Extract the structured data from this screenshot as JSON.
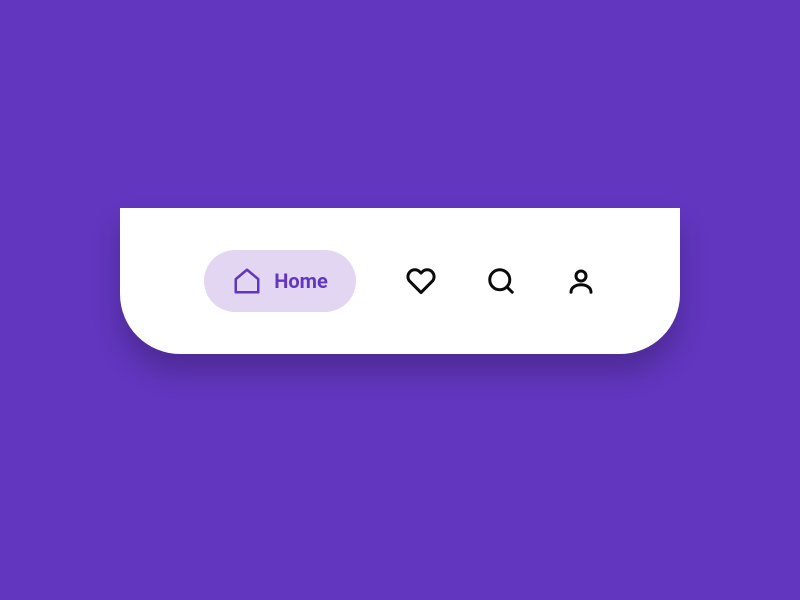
{
  "colors": {
    "background": "#6236bf",
    "surface": "#ffffff",
    "pill": "#e2d6f2",
    "accent": "#6236bf",
    "icon": "#0a0a0a"
  },
  "nav": {
    "active": {
      "label": "Home",
      "icon": "home-icon"
    },
    "items": [
      {
        "icon": "heart-icon"
      },
      {
        "icon": "search-icon"
      },
      {
        "icon": "user-icon"
      }
    ]
  }
}
